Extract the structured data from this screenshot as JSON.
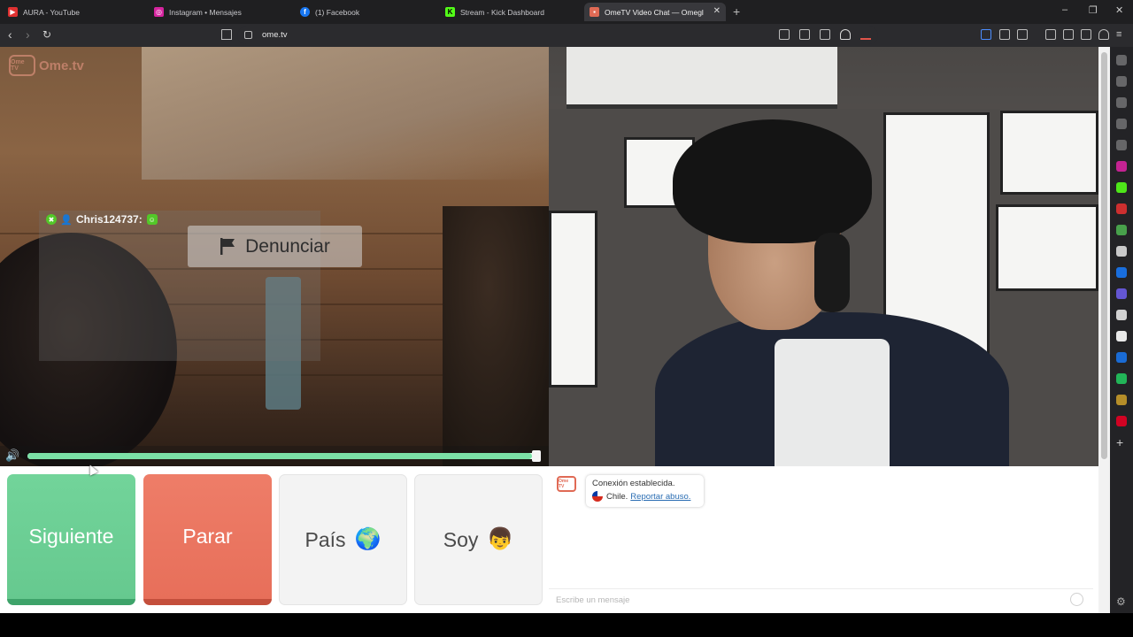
{
  "browser": {
    "tabs": [
      {
        "title": "AURA - YouTube",
        "icon": "youtube-icon",
        "color": "#e03131",
        "active": false
      },
      {
        "title": "Instagram • Mensajes",
        "icon": "instagram-icon",
        "color": "#d6249f",
        "active": false
      },
      {
        "title": "(1) Facebook",
        "icon": "facebook-icon",
        "color": "#1877f2",
        "active": false
      },
      {
        "title": "Stream - Kick Dashboard",
        "icon": "kick-icon",
        "color": "#53fc18",
        "active": false
      },
      {
        "title": "OmeTV Video Chat — Omegl",
        "icon": "ometv-icon",
        "color": "#e06a55",
        "active": true
      }
    ],
    "new_tab": "+",
    "window_controls": [
      "–",
      "❐",
      "✕"
    ],
    "url": "ome.tv"
  },
  "stranger": {
    "logo_text": "Ome.tv",
    "logo_badge": "Ome TV",
    "username": "Chris124737:",
    "report_label": "Denunciar",
    "volume_fraction": 0.99
  },
  "buttons": {
    "next": "Siguiente",
    "stop": "Parar",
    "country": "País",
    "country_emoji": "🌍",
    "gender": "Soy",
    "gender_emoji": "👦"
  },
  "chat": {
    "badge": "Ome TV",
    "message_1": "Conexión establecida.",
    "country": "Chile.",
    "report_link": "Reportar abuso.",
    "input_placeholder": "Escribe un mensaje"
  },
  "colors": {
    "next": "#6bcd94",
    "stop": "#e9735e",
    "accent": "#e06a55",
    "volume_fill": "#7be0a6"
  },
  "extensions": [
    {
      "name": "extension-icon",
      "color": "#9e9e9e"
    },
    {
      "name": "wallet-icon",
      "color": "#9e9e9e"
    },
    {
      "name": "messenger-icon",
      "color": "#9e9e9e"
    },
    {
      "name": "history-icon",
      "color": "#9e9e9e"
    },
    {
      "name": "reader-icon",
      "color": "#9e9e9e"
    },
    {
      "name": "instagram-icon",
      "color": "#d6249f"
    },
    {
      "name": "kick-icon",
      "color": "#53fc18"
    },
    {
      "name": "youtube-icon",
      "color": "#e03131"
    },
    {
      "name": "maps-icon",
      "color": "#4caf50"
    },
    {
      "name": "x-icon",
      "color": "#dddddd"
    },
    {
      "name": "facebook-icon",
      "color": "#1877f2"
    },
    {
      "name": "messenger-app-icon",
      "color": "#6c5ce7"
    },
    {
      "name": "photo-icon",
      "color": "#e5e5e5"
    },
    {
      "name": "tiktok-icon",
      "color": "#ffffff"
    },
    {
      "name": "translate-icon",
      "color": "#1a73e8"
    },
    {
      "name": "vpn-icon",
      "color": "#22c55e"
    },
    {
      "name": "divider-icon",
      "color": "#c79a2a"
    },
    {
      "name": "pinterest-icon",
      "color": "#e60023"
    }
  ]
}
